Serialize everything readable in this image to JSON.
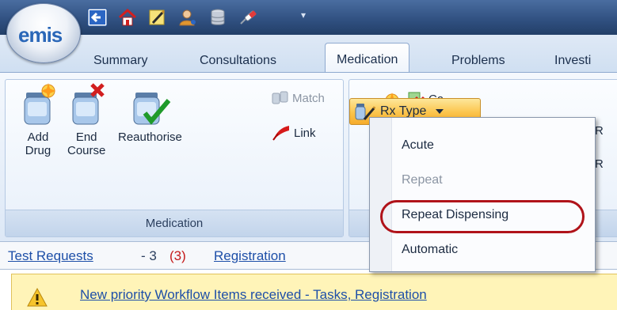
{
  "app": {
    "logo_text": "emis"
  },
  "qat": {
    "icons": [
      "back-arrow-icon",
      "home-icon",
      "pencil-note-icon",
      "user-icon",
      "database-icon",
      "syringe-icon"
    ],
    "menu_glyph": "▾"
  },
  "tabs": [
    {
      "label": "Summary",
      "active": false
    },
    {
      "label": "Consultations",
      "active": false
    },
    {
      "label": "Medication",
      "active": true
    },
    {
      "label": "Problems",
      "active": false
    },
    {
      "label": "Investi",
      "active": false
    }
  ],
  "ribbon": {
    "medication_group": {
      "label": "Medication",
      "add_drug": "Add\nDrug",
      "end_course": "End\nCourse",
      "reauthorise": "Reauthorise",
      "match": "Match",
      "link": "Link",
      "rx_type": "Rx Type"
    },
    "second_group": {
      "ca_label": "Ca",
      "r1": "R",
      "r2": "R"
    }
  },
  "rx_dropdown": {
    "items": [
      {
        "label": "Acute",
        "enabled": true
      },
      {
        "label": "Repeat",
        "enabled": false
      },
      {
        "label": "Repeat Dispensing",
        "enabled": true,
        "highlighted": true
      },
      {
        "label": "Automatic",
        "enabled": true
      }
    ]
  },
  "links_bar": {
    "test_requests": "Test Requests",
    "dash": "- 3",
    "count": "(3)",
    "registration": "Registration"
  },
  "notice": {
    "text": "New priority Workflow Items received - Tasks, Registration"
  },
  "colors": {
    "accent_orange": "#fbc44b",
    "highlight_ring": "#b0131a",
    "link_blue": "#1d4fa8",
    "count_red": "#c51b1b"
  }
}
